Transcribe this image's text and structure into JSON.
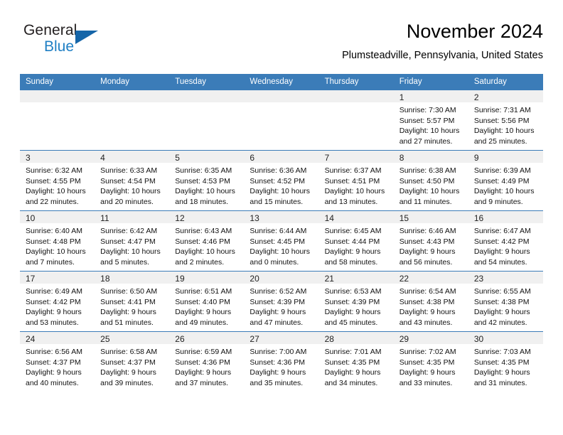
{
  "brand": {
    "name_top": "General",
    "name_bottom": "Blue",
    "logo_color": "#1565a8",
    "text_color": "#1f7fc4"
  },
  "header": {
    "title": "November 2024",
    "location": "Plumsteadville, Pennsylvania, United States"
  },
  "theme": {
    "header_bg": "#3b7cb8",
    "daynum_bg": "#f0f0f0",
    "page_bg": "#ffffff"
  },
  "calendar": {
    "weekday_headers": [
      "Sunday",
      "Monday",
      "Tuesday",
      "Wednesday",
      "Thursday",
      "Friday",
      "Saturday"
    ],
    "weeks": [
      [
        {
          "day": "",
          "sunrise": "",
          "sunset": "",
          "daylight_line1": "",
          "daylight_line2": ""
        },
        {
          "day": "",
          "sunrise": "",
          "sunset": "",
          "daylight_line1": "",
          "daylight_line2": ""
        },
        {
          "day": "",
          "sunrise": "",
          "sunset": "",
          "daylight_line1": "",
          "daylight_line2": ""
        },
        {
          "day": "",
          "sunrise": "",
          "sunset": "",
          "daylight_line1": "",
          "daylight_line2": ""
        },
        {
          "day": "",
          "sunrise": "",
          "sunset": "",
          "daylight_line1": "",
          "daylight_line2": ""
        },
        {
          "day": "1",
          "sunrise": "Sunrise: 7:30 AM",
          "sunset": "Sunset: 5:57 PM",
          "daylight_line1": "Daylight: 10 hours",
          "daylight_line2": "and 27 minutes."
        },
        {
          "day": "2",
          "sunrise": "Sunrise: 7:31 AM",
          "sunset": "Sunset: 5:56 PM",
          "daylight_line1": "Daylight: 10 hours",
          "daylight_line2": "and 25 minutes."
        }
      ],
      [
        {
          "day": "3",
          "sunrise": "Sunrise: 6:32 AM",
          "sunset": "Sunset: 4:55 PM",
          "daylight_line1": "Daylight: 10 hours",
          "daylight_line2": "and 22 minutes."
        },
        {
          "day": "4",
          "sunrise": "Sunrise: 6:33 AM",
          "sunset": "Sunset: 4:54 PM",
          "daylight_line1": "Daylight: 10 hours",
          "daylight_line2": "and 20 minutes."
        },
        {
          "day": "5",
          "sunrise": "Sunrise: 6:35 AM",
          "sunset": "Sunset: 4:53 PM",
          "daylight_line1": "Daylight: 10 hours",
          "daylight_line2": "and 18 minutes."
        },
        {
          "day": "6",
          "sunrise": "Sunrise: 6:36 AM",
          "sunset": "Sunset: 4:52 PM",
          "daylight_line1": "Daylight: 10 hours",
          "daylight_line2": "and 15 minutes."
        },
        {
          "day": "7",
          "sunrise": "Sunrise: 6:37 AM",
          "sunset": "Sunset: 4:51 PM",
          "daylight_line1": "Daylight: 10 hours",
          "daylight_line2": "and 13 minutes."
        },
        {
          "day": "8",
          "sunrise": "Sunrise: 6:38 AM",
          "sunset": "Sunset: 4:50 PM",
          "daylight_line1": "Daylight: 10 hours",
          "daylight_line2": "and 11 minutes."
        },
        {
          "day": "9",
          "sunrise": "Sunrise: 6:39 AM",
          "sunset": "Sunset: 4:49 PM",
          "daylight_line1": "Daylight: 10 hours",
          "daylight_line2": "and 9 minutes."
        }
      ],
      [
        {
          "day": "10",
          "sunrise": "Sunrise: 6:40 AM",
          "sunset": "Sunset: 4:48 PM",
          "daylight_line1": "Daylight: 10 hours",
          "daylight_line2": "and 7 minutes."
        },
        {
          "day": "11",
          "sunrise": "Sunrise: 6:42 AM",
          "sunset": "Sunset: 4:47 PM",
          "daylight_line1": "Daylight: 10 hours",
          "daylight_line2": "and 5 minutes."
        },
        {
          "day": "12",
          "sunrise": "Sunrise: 6:43 AM",
          "sunset": "Sunset: 4:46 PM",
          "daylight_line1": "Daylight: 10 hours",
          "daylight_line2": "and 2 minutes."
        },
        {
          "day": "13",
          "sunrise": "Sunrise: 6:44 AM",
          "sunset": "Sunset: 4:45 PM",
          "daylight_line1": "Daylight: 10 hours",
          "daylight_line2": "and 0 minutes."
        },
        {
          "day": "14",
          "sunrise": "Sunrise: 6:45 AM",
          "sunset": "Sunset: 4:44 PM",
          "daylight_line1": "Daylight: 9 hours",
          "daylight_line2": "and 58 minutes."
        },
        {
          "day": "15",
          "sunrise": "Sunrise: 6:46 AM",
          "sunset": "Sunset: 4:43 PM",
          "daylight_line1": "Daylight: 9 hours",
          "daylight_line2": "and 56 minutes."
        },
        {
          "day": "16",
          "sunrise": "Sunrise: 6:47 AM",
          "sunset": "Sunset: 4:42 PM",
          "daylight_line1": "Daylight: 9 hours",
          "daylight_line2": "and 54 minutes."
        }
      ],
      [
        {
          "day": "17",
          "sunrise": "Sunrise: 6:49 AM",
          "sunset": "Sunset: 4:42 PM",
          "daylight_line1": "Daylight: 9 hours",
          "daylight_line2": "and 53 minutes."
        },
        {
          "day": "18",
          "sunrise": "Sunrise: 6:50 AM",
          "sunset": "Sunset: 4:41 PM",
          "daylight_line1": "Daylight: 9 hours",
          "daylight_line2": "and 51 minutes."
        },
        {
          "day": "19",
          "sunrise": "Sunrise: 6:51 AM",
          "sunset": "Sunset: 4:40 PM",
          "daylight_line1": "Daylight: 9 hours",
          "daylight_line2": "and 49 minutes."
        },
        {
          "day": "20",
          "sunrise": "Sunrise: 6:52 AM",
          "sunset": "Sunset: 4:39 PM",
          "daylight_line1": "Daylight: 9 hours",
          "daylight_line2": "and 47 minutes."
        },
        {
          "day": "21",
          "sunrise": "Sunrise: 6:53 AM",
          "sunset": "Sunset: 4:39 PM",
          "daylight_line1": "Daylight: 9 hours",
          "daylight_line2": "and 45 minutes."
        },
        {
          "day": "22",
          "sunrise": "Sunrise: 6:54 AM",
          "sunset": "Sunset: 4:38 PM",
          "daylight_line1": "Daylight: 9 hours",
          "daylight_line2": "and 43 minutes."
        },
        {
          "day": "23",
          "sunrise": "Sunrise: 6:55 AM",
          "sunset": "Sunset: 4:38 PM",
          "daylight_line1": "Daylight: 9 hours",
          "daylight_line2": "and 42 minutes."
        }
      ],
      [
        {
          "day": "24",
          "sunrise": "Sunrise: 6:56 AM",
          "sunset": "Sunset: 4:37 PM",
          "daylight_line1": "Daylight: 9 hours",
          "daylight_line2": "and 40 minutes."
        },
        {
          "day": "25",
          "sunrise": "Sunrise: 6:58 AM",
          "sunset": "Sunset: 4:37 PM",
          "daylight_line1": "Daylight: 9 hours",
          "daylight_line2": "and 39 minutes."
        },
        {
          "day": "26",
          "sunrise": "Sunrise: 6:59 AM",
          "sunset": "Sunset: 4:36 PM",
          "daylight_line1": "Daylight: 9 hours",
          "daylight_line2": "and 37 minutes."
        },
        {
          "day": "27",
          "sunrise": "Sunrise: 7:00 AM",
          "sunset": "Sunset: 4:36 PM",
          "daylight_line1": "Daylight: 9 hours",
          "daylight_line2": "and 35 minutes."
        },
        {
          "day": "28",
          "sunrise": "Sunrise: 7:01 AM",
          "sunset": "Sunset: 4:35 PM",
          "daylight_line1": "Daylight: 9 hours",
          "daylight_line2": "and 34 minutes."
        },
        {
          "day": "29",
          "sunrise": "Sunrise: 7:02 AM",
          "sunset": "Sunset: 4:35 PM",
          "daylight_line1": "Daylight: 9 hours",
          "daylight_line2": "and 33 minutes."
        },
        {
          "day": "30",
          "sunrise": "Sunrise: 7:03 AM",
          "sunset": "Sunset: 4:35 PM",
          "daylight_line1": "Daylight: 9 hours",
          "daylight_line2": "and 31 minutes."
        }
      ]
    ]
  }
}
